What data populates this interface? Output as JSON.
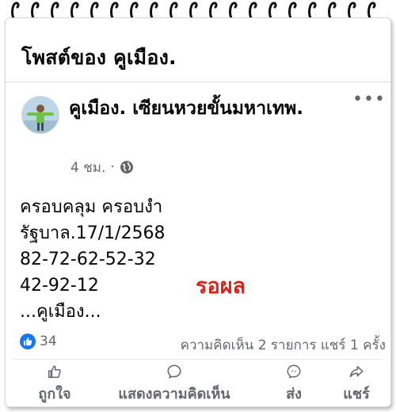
{
  "header": {
    "title": "โพสต์ของ คูเมือง."
  },
  "post": {
    "author": "คูเมือง. เซียนหวยขั้นมหาเทพ.",
    "timestamp": "4 ชม.",
    "separator": "·",
    "privacy_icon": "globe-icon",
    "more_icon": "more-options-icon",
    "more_label": "•••",
    "lines": [
      "ครอบคลุม ครอบงำ",
      "รัฐบาล.17/1/2568",
      "82-72-62-52-32",
      "42-92-12",
      "...คูเมือง..."
    ],
    "stamp": {
      "text": "รอผล",
      "color": "#d8231b"
    }
  },
  "stats": {
    "reaction_icon": "like-reaction-icon",
    "reaction_count": "34",
    "comments_shares": "ความคิดเห็น 2 รายการ  แชร์ 1 ครั้ง"
  },
  "actions": [
    {
      "label": "ถูกใจ",
      "icon": "thumbs-up-icon"
    },
    {
      "label": "แสดงความคิดเห็น",
      "icon": "comment-icon"
    },
    {
      "label": "ส่ง",
      "icon": "messenger-icon"
    },
    {
      "label": "แชร์",
      "icon": "share-icon"
    }
  ],
  "colors": {
    "accent": "#1877f2",
    "muted": "#65676b",
    "text": "#050505"
  }
}
